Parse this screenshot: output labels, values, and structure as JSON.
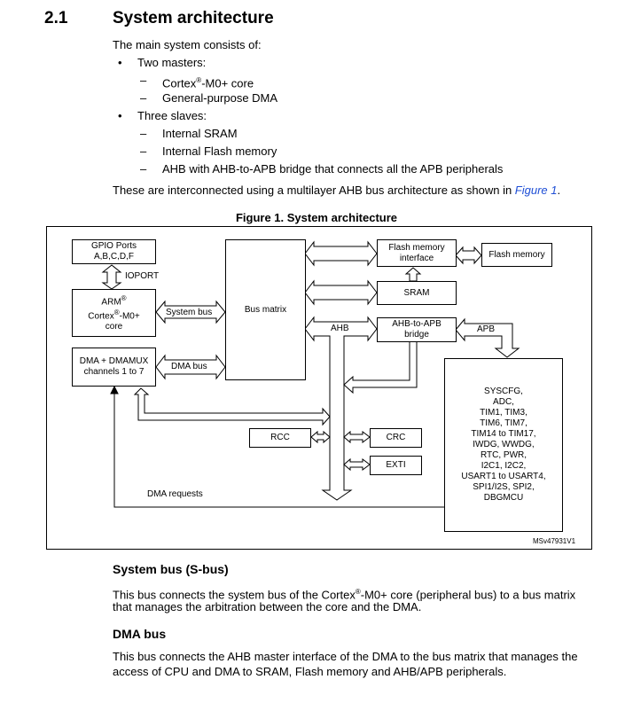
{
  "section": {
    "number": "2.1",
    "title": "System architecture"
  },
  "intro": "The main system consists of:",
  "list": [
    {
      "label": "Two masters:",
      "items": [
        {
          "pre": "Cortex",
          "sup": "®",
          "post": "-M0+ core"
        },
        {
          "pre": "General-purpose DMA",
          "sup": "",
          "post": ""
        }
      ]
    },
    {
      "label": "Three slaves:",
      "items": [
        {
          "pre": "Internal SRAM",
          "sup": "",
          "post": ""
        },
        {
          "pre": "Internal Flash memory",
          "sup": "",
          "post": ""
        },
        {
          "pre": "AHB with AHB-to-APB bridge that connects all the APB peripherals",
          "sup": "",
          "post": ""
        }
      ]
    }
  ],
  "bullet": "•",
  "dash": "–",
  "interconnect": {
    "text": "These are interconnected using a multilayer AHB bus architecture as shown in ",
    "link": "Figure 1",
    "end": "."
  },
  "figure": {
    "title": "Figure 1. System architecture",
    "gpio": [
      "GPIO Ports",
      "A,B,C,D,F"
    ],
    "ioport": "IOPORT",
    "arm": {
      "l1": "ARM",
      "sup": "®",
      "l2a": "Cortex",
      "l2b": "-M0+",
      "l3": "core"
    },
    "dma": [
      "DMA + DMAMUX",
      "channels 1 to 7"
    ],
    "system_bus": "System bus",
    "dma_bus": "DMA bus",
    "bus_matrix": "Bus matrix",
    "flash_iface": [
      "Flash memory",
      "interface"
    ],
    "flash": "Flash memory",
    "sram": "SRAM",
    "bridge": [
      "AHB-to-APB",
      "bridge"
    ],
    "ahb": "AHB",
    "apb": "APB",
    "rcc": "RCC",
    "crc": "CRC",
    "exti": "EXTI",
    "dma_requests": "DMA requests",
    "peripherals": [
      "SYSCFG,",
      "ADC,",
      "TIM1, TIM3,",
      "TIM6, TIM7,",
      "TIM14 to TIM17,",
      "IWDG, WWDG,",
      "RTC, PWR,",
      "I2C1, I2C2,",
      "USART1 to USART4,",
      "SPI1/I2S, SPI2,",
      "DBGMCU"
    ],
    "id": "MSv47931V1"
  },
  "sbus": {
    "title": "System bus (S-bus)",
    "t1a": "This bus connects the system bus of the Cortex",
    "sup": "®",
    "t1b": "-M0+ core (peripheral bus) to a bus matrix",
    "t2": "that manages the arbitration between the core and the DMA."
  },
  "dbus": {
    "title": "DMA bus",
    "t1": "This bus connects the AHB master interface of the DMA to the bus matrix that manages the",
    "t2": "access of CPU and DMA to SRAM, Flash memory and AHB/APB peripherals."
  }
}
